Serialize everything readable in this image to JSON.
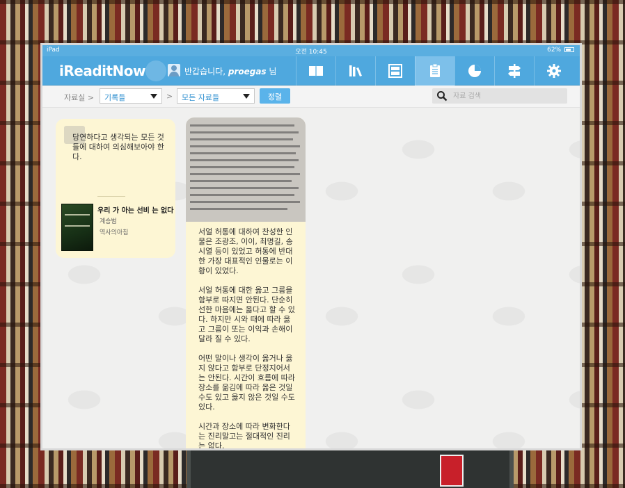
{
  "statusbar": {
    "carrier": "iPad",
    "time": "오전 10:45",
    "battery": "62%"
  },
  "navbar": {
    "logo": "iReaditNow",
    "greeting_prefix": "반갑습니다, ",
    "username": "proegas",
    "greeting_suffix": " 님",
    "icons": [
      "book-icon",
      "library-icon",
      "archive-icon",
      "notes-icon",
      "pie-chart-icon",
      "signpost-icon",
      "gear-icon"
    ],
    "active_icon": "notes-icon"
  },
  "toolbar": {
    "breadcrumb": "자료실 >",
    "category_select": "기록들",
    "separator": ">",
    "type_select": "모든 자료들",
    "sort_label": "정렬",
    "search_placeholder": "자료 검색"
  },
  "cards": [
    {
      "quote": "당연하다고 생각되는 모든 것들에 대하여 의심해보아야 한다.",
      "book_title": "우리 가 아는 선비 는 없다",
      "author": "계승범",
      "publisher": "역사의아침"
    },
    {
      "paragraphs": [
        "서얼 허통에 대하여 찬성한 인물은 조광조, 이이, 최명길, 송시열 등이 있었고 허통에 반대한 가장 대표적인 인물로는 이황이 있었다.",
        "서얼 허통에 대한 옳고 그름을 함부로 따지면 안된다. 단순히 선한 마음에는 옳다고 할 수 있다. 하지만 시와 때에 따라 옳고 그름이 또는 이익과 손해이 달라 질 수 있다.",
        "어떤 말이나 생각이 옳거나 옳지 않다고 함부로 단정지어서는 안된다. 시간이 흐름에 따라 장소를 옮김에 따라 옳은 것일 수도 있고 옳지 않은 것일 수도 있다.",
        "시간과 장소에 따라 변화한다는 진리말고는 절대적인 진리는 없다."
      ]
    }
  ],
  "colors": {
    "nav": "#4fa8de",
    "card": "#fdf6d4",
    "accent": "#5ab3ea"
  }
}
